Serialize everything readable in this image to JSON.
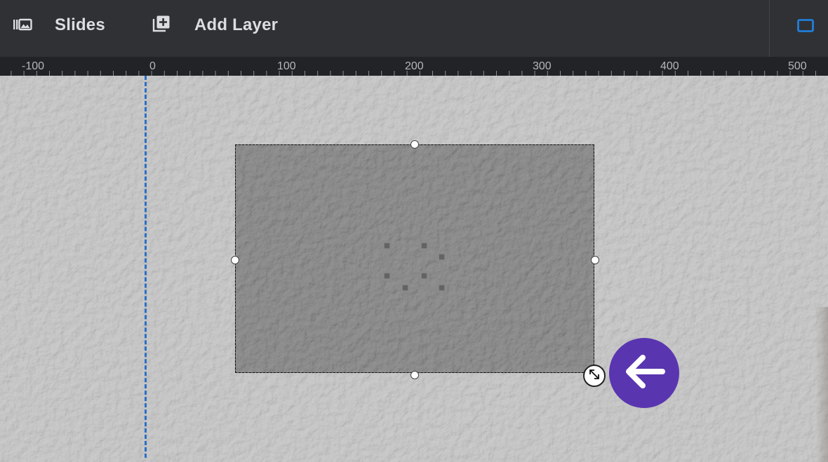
{
  "toolbar": {
    "slides_label": "Slides",
    "add_layer_label": "Add Layer",
    "slides_icon": "slides-library-icon",
    "add_layer_icon": "add-layer-icon",
    "device_icon": "desktop-view-icon"
  },
  "ruler": {
    "ticks": [
      "-100",
      "0",
      "100",
      "200",
      "300",
      "400",
      "500"
    ]
  },
  "layer": {
    "icon": "shape-layer-icon"
  },
  "handles": {
    "resize_icon": "resize-diagonal-icon"
  },
  "fab": {
    "icon": "arrow-left-icon"
  },
  "colors": {
    "toolbar_bg": "#303135",
    "ruler_bg": "#222326",
    "canvas_bg": "#cbcbcb",
    "layer_bg": "#636363",
    "guide": "#2a6fc6",
    "fab_bg": "#5a35b0",
    "device_icon": "#1f84e6"
  }
}
